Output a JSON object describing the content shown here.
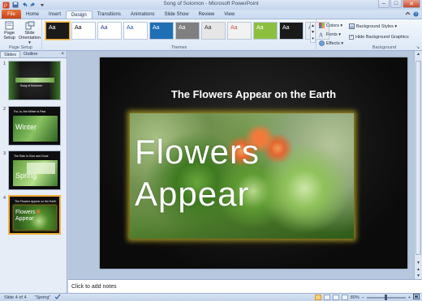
{
  "window": {
    "title": "Song of Solomon - Microsoft PowerPoint",
    "controls": {
      "minimize": "–",
      "maximize": "□",
      "close": "✕"
    }
  },
  "quick_access": {
    "icons": [
      "save-icon",
      "undo-icon",
      "redo-icon",
      "customize-icon"
    ]
  },
  "ribbon_tabs": {
    "file": "File",
    "tabs": [
      "Home",
      "Insert",
      "Design",
      "Transitions",
      "Animations",
      "Slide Show",
      "Review",
      "View"
    ],
    "active": "Design"
  },
  "ribbon": {
    "page_setup": {
      "label": "Page Setup",
      "page_setup_btn": "Page Setup",
      "orientation_btn": "Slide Orientation ▾"
    },
    "themes": {
      "label": "Themes",
      "items": [
        {
          "label": "Aa",
          "bg": "#1a1a1a",
          "fg": "#ffffff",
          "selected": true
        },
        {
          "label": "Aa",
          "bg": "#ffffff",
          "fg": "#000000"
        },
        {
          "label": "Aa",
          "bg": "#ffffff",
          "fg": "#1f3e7a"
        },
        {
          "label": "Aa",
          "bg": "#ffffff",
          "fg": "#1f5fa6"
        },
        {
          "label": "Aa",
          "bg": "#1f6fb4",
          "fg": "#ffffff"
        },
        {
          "label": "Aa",
          "bg": "#7f7f7f",
          "fg": "#ffffff"
        },
        {
          "label": "Aa",
          "bg": "#e6e6e6",
          "fg": "#333333"
        },
        {
          "label": "Aa",
          "bg": "#f2f2f2",
          "fg": "#c0504d"
        },
        {
          "label": "Aa",
          "bg": "#8cbf3f",
          "fg": "#ffffff"
        },
        {
          "label": "Aa",
          "bg": "#1a1a1a",
          "fg": "#ffffff"
        },
        {
          "label": "Aa",
          "bg": "#e8ebef",
          "fg": "#5a6e8c"
        }
      ]
    },
    "theme_options": {
      "colors": "Colors ▾",
      "fonts": "Fonts ▾",
      "effects": "Effects ▾"
    },
    "background": {
      "label": "Background",
      "styles_btn": "Background Styles ▾",
      "hide_graphics_label": "Hide Background Graphics"
    }
  },
  "slides_panel": {
    "tab_slides": "Slides",
    "tab_outline": "Outline",
    "close": "×",
    "thumbnails": [
      {
        "number": "1",
        "title": "Song of Solomon",
        "big": ""
      },
      {
        "number": "2",
        "title": "For, lo, the Winter is Past",
        "big": "Winter"
      },
      {
        "number": "3",
        "title": "The Rain is Over and Gone",
        "big": "Spring"
      },
      {
        "number": "4",
        "title": "The Flowers Appear on the Earth",
        "big": "Flowers Appear"
      }
    ],
    "selected": 4
  },
  "slide": {
    "title": "The Flowers Appear on the Earth",
    "line1": "Flowers",
    "line2": "Appear"
  },
  "notes": {
    "placeholder": "Click to add notes"
  },
  "status": {
    "slide_info": "Slide 4 of 4",
    "theme_name": "\"Spring\"",
    "zoom": "80%",
    "zoom_minus": "–",
    "zoom_plus": "+"
  },
  "scroll": {
    "up": "▲",
    "down": "▼",
    "prev": "▲",
    "next": "▼"
  }
}
